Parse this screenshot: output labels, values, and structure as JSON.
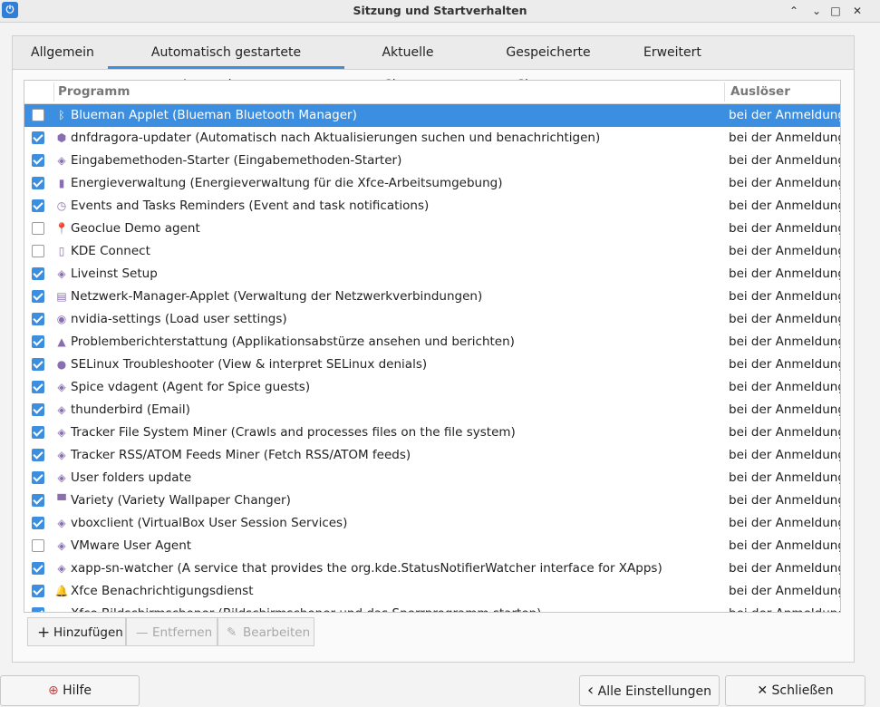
{
  "window": {
    "title": "Sitzung und Startverhalten",
    "controls": {
      "help": "?",
      "minimize_icon": "chevron-up-icon",
      "min": "⌃",
      "restore": "▫",
      "close": "✕"
    }
  },
  "tabs": [
    {
      "label": "Allgemein",
      "active": false
    },
    {
      "label": "Automatisch gestartete Anwendungen",
      "active": true
    },
    {
      "label": "Aktuelle Sitzung",
      "active": false
    },
    {
      "label": "Gespeicherte Sitzungen",
      "active": false
    },
    {
      "label": "Erweitert",
      "active": false
    }
  ],
  "table": {
    "columns": {
      "program": "Programm",
      "trigger": "Auslöser"
    },
    "rows": [
      {
        "checked": false,
        "selected": true,
        "icon": "bluetooth-icon",
        "glyph": "ᛒ",
        "name": "Blueman Applet (Blueman Bluetooth Manager)",
        "trigger": "bei der Anmeldung"
      },
      {
        "checked": true,
        "icon": "dnfdragora-icon",
        "glyph": "⬢",
        "name": "dnfdragora-updater (Automatisch nach Aktualisierungen suchen und benachrichtigen)",
        "trigger": "bei der Anmeldung"
      },
      {
        "checked": true,
        "icon": "generic-app-icon",
        "glyph": "◈",
        "name": "Eingabemethoden-Starter (Eingabemethoden-Starter)",
        "trigger": "bei der Anmeldung"
      },
      {
        "checked": true,
        "icon": "battery-icon",
        "glyph": "▮",
        "name": "Energieverwaltung (Energieverwaltung für die Xfce-Arbeitsumgebung)",
        "trigger": "bei der Anmeldung"
      },
      {
        "checked": true,
        "icon": "clock-icon",
        "glyph": "◷",
        "name": "Events and Tasks Reminders (Event and task notifications)",
        "trigger": "bei der Anmeldung"
      },
      {
        "checked": false,
        "icon": "map-pin-icon",
        "glyph": "📍",
        "name": "Geoclue Demo agent",
        "trigger": "bei der Anmeldung"
      },
      {
        "checked": false,
        "icon": "phone-icon",
        "glyph": "▯",
        "name": "KDE Connect",
        "trigger": "bei der Anmeldung"
      },
      {
        "checked": true,
        "icon": "generic-app-icon",
        "glyph": "◈",
        "name": "Liveinst Setup",
        "trigger": "bei der Anmeldung"
      },
      {
        "checked": true,
        "icon": "network-icon",
        "glyph": "▤",
        "name": "Netzwerk-Manager-Applet (Verwaltung der Netzwerkverbindungen)",
        "trigger": "bei der Anmeldung"
      },
      {
        "checked": true,
        "icon": "nvidia-icon",
        "glyph": "◉",
        "name": "nvidia-settings (Load user settings)",
        "trigger": "bei der Anmeldung"
      },
      {
        "checked": true,
        "icon": "alarm-icon",
        "glyph": "▲",
        "name": "Problemberichterstattung (Applikationsabstürze ansehen und berichten)",
        "trigger": "bei der Anmeldung"
      },
      {
        "checked": true,
        "icon": "selinux-icon",
        "glyph": "●",
        "name": "SELinux Troubleshooter (View & interpret SELinux denials)",
        "trigger": "bei der Anmeldung"
      },
      {
        "checked": true,
        "icon": "generic-app-icon",
        "glyph": "◈",
        "name": "Spice vdagent (Agent for Spice guests)",
        "trigger": "bei der Anmeldung"
      },
      {
        "checked": true,
        "icon": "generic-app-icon",
        "glyph": "◈",
        "name": "thunderbird (Email)",
        "trigger": "bei der Anmeldung"
      },
      {
        "checked": true,
        "icon": "generic-app-icon",
        "glyph": "◈",
        "name": "Tracker File System Miner (Crawls and processes files on the file system)",
        "trigger": "bei der Anmeldung"
      },
      {
        "checked": true,
        "icon": "generic-app-icon",
        "glyph": "◈",
        "name": "Tracker RSS/ATOM Feeds Miner (Fetch RSS/ATOM feeds)",
        "trigger": "bei der Anmeldung"
      },
      {
        "checked": true,
        "icon": "generic-app-icon",
        "glyph": "◈",
        "name": "User folders update",
        "trigger": "bei der Anmeldung"
      },
      {
        "checked": true,
        "icon": "wallpaper-icon",
        "glyph": "▀",
        "name": "Variety (Variety Wallpaper Changer)",
        "trigger": "bei der Anmeldung"
      },
      {
        "checked": true,
        "icon": "generic-app-icon",
        "glyph": "◈",
        "name": "vboxclient (VirtualBox User Session Services)",
        "trigger": "bei der Anmeldung"
      },
      {
        "checked": false,
        "icon": "generic-app-icon",
        "glyph": "◈",
        "name": "VMware User Agent",
        "trigger": "bei der Anmeldung"
      },
      {
        "checked": true,
        "icon": "generic-app-icon",
        "glyph": "◈",
        "name": "xapp-sn-watcher (A service that provides the org.kde.StatusNotifierWatcher interface for XApps)",
        "trigger": "bei der Anmeldung"
      },
      {
        "checked": true,
        "icon": "bell-icon",
        "glyph": "🔔",
        "name": "Xfce Benachrichtigungsdienst",
        "trigger": "bei der Anmeldung"
      },
      {
        "checked": true,
        "icon": "screensaver-icon",
        "glyph": "▪",
        "name": "Xfce Bildschirmschoner (Bildschirmschoner und das Sperrprogramm starten)",
        "trigger": "bei der Anmeldung"
      }
    ]
  },
  "toolbar": {
    "add": {
      "glyph": "+",
      "label": "Hinzufügen"
    },
    "remove": {
      "glyph": "—",
      "label": "Entfernen"
    },
    "edit": {
      "glyph": "✎",
      "label": "Bearbeiten"
    }
  },
  "footer": {
    "help": {
      "glyph": "⊕",
      "label": "Hilfe"
    },
    "all_settings": {
      "glyph": "‹",
      "label": "Alle Einstellungen"
    },
    "close": {
      "glyph": "✕",
      "label": "Schließen"
    }
  },
  "colors": {
    "accent": "#3b8ee0"
  }
}
